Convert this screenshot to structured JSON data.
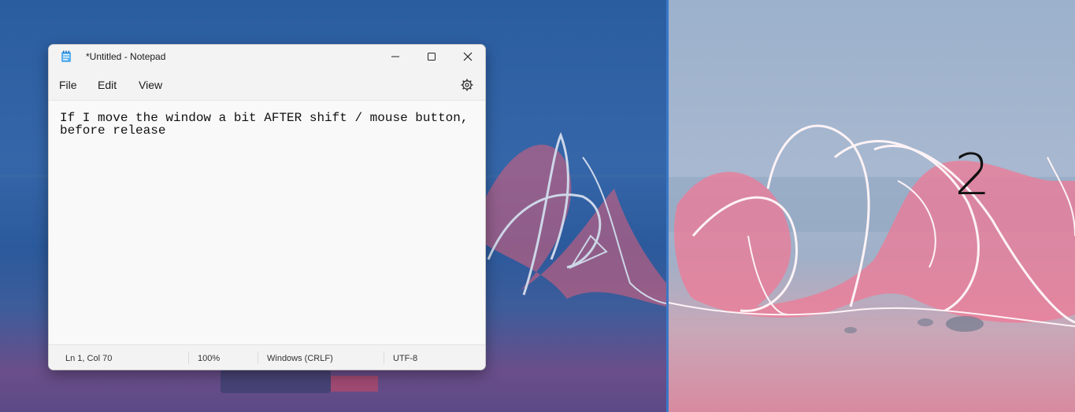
{
  "notepad": {
    "title": "*Untitled - Notepad",
    "icon": "notepad-app-icon",
    "controls": {
      "minimize": "minimize-icon",
      "maximize": "maximize-icon",
      "close": "close-icon"
    },
    "menus": [
      "File",
      "Edit",
      "View"
    ],
    "settings_icon": "gear-icon",
    "text": "If I move the window a bit AFTER shift / mouse button,\nbefore release",
    "status": {
      "position": "Ln 1, Col 70",
      "zoom": "100%",
      "line_ending": "Windows (CRLF)",
      "encoding": "UTF-8"
    }
  },
  "snap_zone": {
    "label": "2"
  },
  "colors": {
    "snap_divider": "#3a78c8",
    "left_wallpaper": "#2a5da0",
    "right_wallpaper": "#a8b8d0"
  }
}
